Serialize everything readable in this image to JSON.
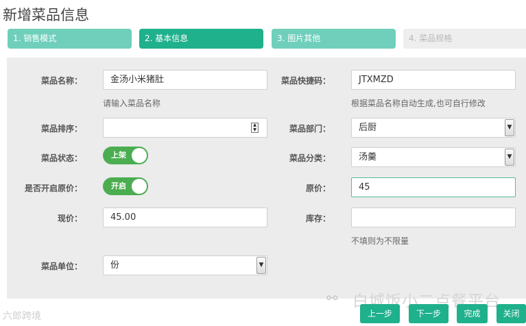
{
  "page": {
    "title": "新增菜品信息"
  },
  "steps": [
    {
      "label": "1. 销售模式"
    },
    {
      "label": "2. 基本信息"
    },
    {
      "label": "3. 图片其他"
    },
    {
      "label": "4. 菜品规格"
    }
  ],
  "form": {
    "dish_name": {
      "label": "菜品名称：",
      "value": "金汤小米猪肚",
      "help": "请输入菜品名称"
    },
    "quick_code": {
      "label": "菜品快捷码：",
      "value": "JTXMZD",
      "help": "根据菜品名称自动生成,也可自行修改"
    },
    "sort_order": {
      "label": "菜品排序：",
      "value": ""
    },
    "department": {
      "label": "菜品部门：",
      "value": "后厨"
    },
    "status": {
      "label": "菜品状态：",
      "toggle_text": "上架",
      "on": true
    },
    "category": {
      "label": "菜品分类：",
      "value": "汤羹"
    },
    "enable_original_price": {
      "label": "是否开启原价：",
      "toggle_text": "开启",
      "on": true
    },
    "original_price": {
      "label": "原价：",
      "value": "45"
    },
    "current_price": {
      "label": "现价：",
      "value": "45.00"
    },
    "stock": {
      "label": "库存：",
      "value": "",
      "help": "不填则为不限量"
    },
    "unit": {
      "label": "菜品单位：",
      "value": "份"
    }
  },
  "buttons": {
    "prev": "上一步",
    "next": "下一步",
    "finish": "完成",
    "close": "关闭"
  },
  "watermark": {
    "main": "白城饭小二点餐平台",
    "corner": "六郎跨境"
  },
  "colors": {
    "accent": "#1fb08c",
    "step_light": "#6fcfbb",
    "toggle_green": "#4bad50"
  }
}
